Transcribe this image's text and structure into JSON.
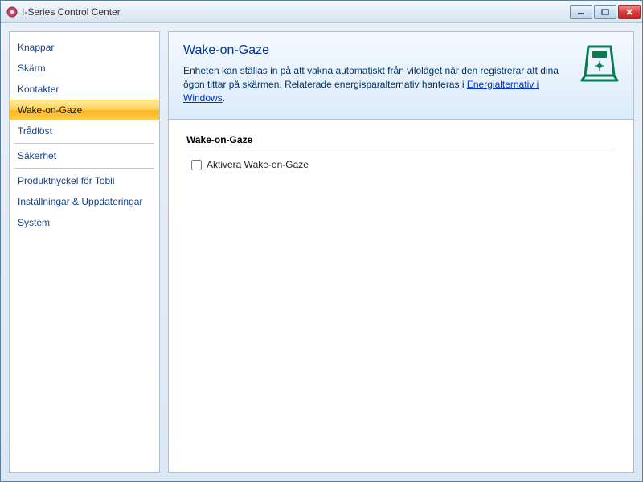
{
  "window": {
    "title": "I-Series Control Center"
  },
  "sidebar": {
    "groups": [
      {
        "items": [
          {
            "label": "Knappar",
            "selected": false
          },
          {
            "label": "Skärm",
            "selected": false
          },
          {
            "label": "Kontakter",
            "selected": false
          },
          {
            "label": "Wake-on-Gaze",
            "selected": true
          },
          {
            "label": "Trådlöst",
            "selected": false
          }
        ]
      },
      {
        "items": [
          {
            "label": "Säkerhet",
            "selected": false
          }
        ]
      },
      {
        "items": [
          {
            "label": "Produktnyckel för Tobii",
            "selected": false
          },
          {
            "label": "Inställningar & Uppdateringar",
            "selected": false
          },
          {
            "label": "System",
            "selected": false
          }
        ]
      }
    ]
  },
  "header": {
    "title": "Wake-on-Gaze",
    "desc_pre": "Enheten kan ställas in på att vakna automatiskt från viloläget när den registrerar att dina ögon tittar på skärmen. Relaterade energisparalternativ hanteras i ",
    "link_text": "Energialternativ i Windows",
    "desc_post": "."
  },
  "section": {
    "title": "Wake-on-Gaze",
    "checkbox_label": "Aktivera Wake-on-Gaze",
    "checkbox_checked": false
  },
  "colors": {
    "accent_link": "#0033cc",
    "selected_gradient_top": "#ffe9a8",
    "selected_gradient_bottom": "#ffcf4a"
  }
}
